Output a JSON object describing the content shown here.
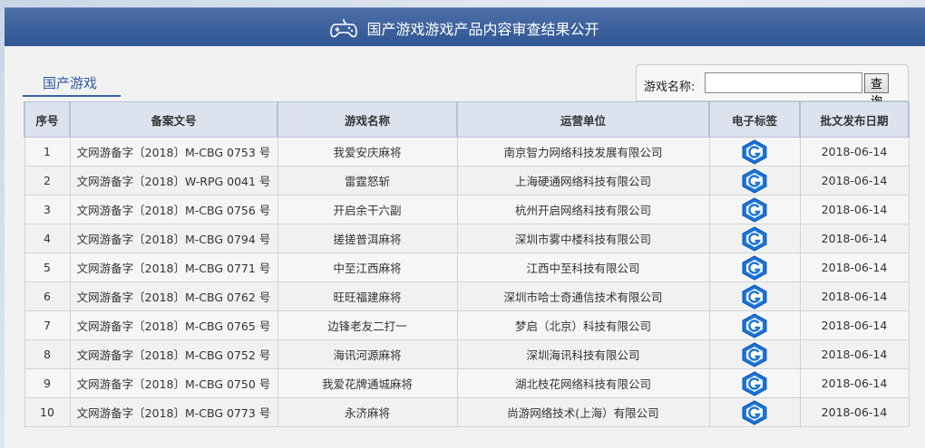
{
  "header": {
    "title": "国产游戏游戏产品内容审查结果公开",
    "icon": "gamepad-icon"
  },
  "tab": {
    "label": "国产游戏"
  },
  "search": {
    "label": "游戏名称:",
    "placeholder": "",
    "value": "",
    "button": "查询"
  },
  "table": {
    "columns": [
      "序号",
      "备案文号",
      "游戏名称",
      "运营单位",
      "电子标签",
      "批文发布日期"
    ],
    "rows": [
      {
        "no": "1",
        "ref": "文网游备字〔2018〕M-CBG 0753 号",
        "name": "我爱安庆麻将",
        "company": "南京智力网络科技发展有限公司",
        "date": "2018-06-14"
      },
      {
        "no": "2",
        "ref": "文网游备字〔2018〕W-RPG 0041 号",
        "name": "雷霆怒斩",
        "company": "上海硬通网络科技有限公司",
        "date": "2018-06-14"
      },
      {
        "no": "3",
        "ref": "文网游备字〔2018〕M-CBG 0756 号",
        "name": "开启余干六副",
        "company": "杭州开启网络科技有限公司",
        "date": "2018-06-14"
      },
      {
        "no": "4",
        "ref": "文网游备字〔2018〕M-CBG 0794 号",
        "name": "搓搓普洱麻将",
        "company": "深圳市雾中楼科技有限公司",
        "date": "2018-06-14"
      },
      {
        "no": "5",
        "ref": "文网游备字〔2018〕M-CBG 0771 号",
        "name": "中至江西麻将",
        "company": "江西中至科技有限公司",
        "date": "2018-06-14"
      },
      {
        "no": "6",
        "ref": "文网游备字〔2018〕M-CBG 0762 号",
        "name": "旺旺福建麻将",
        "company": "深圳市哈士奇通信技术有限公司",
        "date": "2018-06-14"
      },
      {
        "no": "7",
        "ref": "文网游备字〔2018〕M-CBG 0765 号",
        "name": "边锋老友二打一",
        "company": "梦启（北京）科技有限公司",
        "date": "2018-06-14"
      },
      {
        "no": "8",
        "ref": "文网游备字〔2018〕M-CBG 0752 号",
        "name": "海讯河源麻将",
        "company": "深圳海讯科技有限公司",
        "date": "2018-06-14"
      },
      {
        "no": "9",
        "ref": "文网游备字〔2018〕M-CBG 0750 号",
        "name": "我爱花牌通城麻将",
        "company": "湖北枝花网络科技有限公司",
        "date": "2018-06-14"
      },
      {
        "no": "10",
        "ref": "文网游备字〔2018〕M-CBG 0773 号",
        "name": "永济麻将",
        "company": "尚游网络技术(上海）有限公司",
        "date": "2018-06-14"
      }
    ]
  },
  "colors": {
    "header": "#3a5f9c",
    "badge": "#1a73d9",
    "tab": "#2f5aa0"
  }
}
